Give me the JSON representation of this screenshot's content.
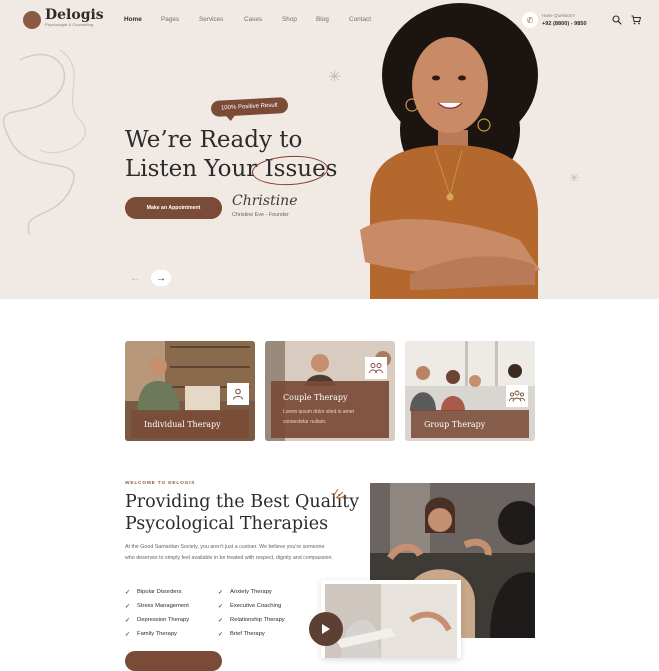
{
  "brand": {
    "name": "Delogis",
    "tagline": "Psychologist & Counselling"
  },
  "nav": {
    "items": [
      {
        "label": "Home",
        "active": true
      },
      {
        "label": "Pages"
      },
      {
        "label": "Services"
      },
      {
        "label": "Cases"
      },
      {
        "label": "Shop"
      },
      {
        "label": "Blog"
      },
      {
        "label": "Contact"
      }
    ],
    "phone_label": "Have Question?",
    "phone_number": "+92 (8800) - 9850",
    "icons": [
      "phone-icon",
      "search-icon",
      "cart-icon"
    ]
  },
  "hero": {
    "badge": "100% Positive Result",
    "headline_line1": "We’re Ready to",
    "headline_line2_a": "Listen Your ",
    "headline_line2_b": "Issues",
    "cta": "Make an Appointment",
    "signature": "Christine",
    "signer": "Christine Eve - Founder",
    "prev_arrow": "←",
    "next_arrow": "→"
  },
  "services": [
    {
      "title": "Individual Therapy",
      "icon": "person-icon"
    },
    {
      "title": "Couple Therapy",
      "desc": "Lorem ipsum dolor sited is amet consectetur nullam.",
      "icon": "couple-icon"
    },
    {
      "title": "Group Therapy",
      "icon": "group-icon"
    }
  ],
  "about": {
    "eyebrow": "WELCOME TO DELOGIS",
    "title_line1": "Providing the Best Quality",
    "title_line2": "Psycological Therapies",
    "desc": "At the Good Samaritan Society, you aren’t just a custoer. We believe you’re someone who deserves to simply feel available in be treated with respect, dignity and compassion.",
    "list_left": [
      "Bipolar Disorders",
      "Stress Management",
      "Depression Therapy",
      "Family Therapy"
    ],
    "list_right": [
      "Anxiety Therapy",
      "Executive Coaching",
      "Relationship Therapy",
      "Brief Therapy"
    ]
  },
  "colors": {
    "accent": "#7a4b37",
    "hero_bg": "#f1e9e4",
    "text": "#2b2b2b"
  }
}
